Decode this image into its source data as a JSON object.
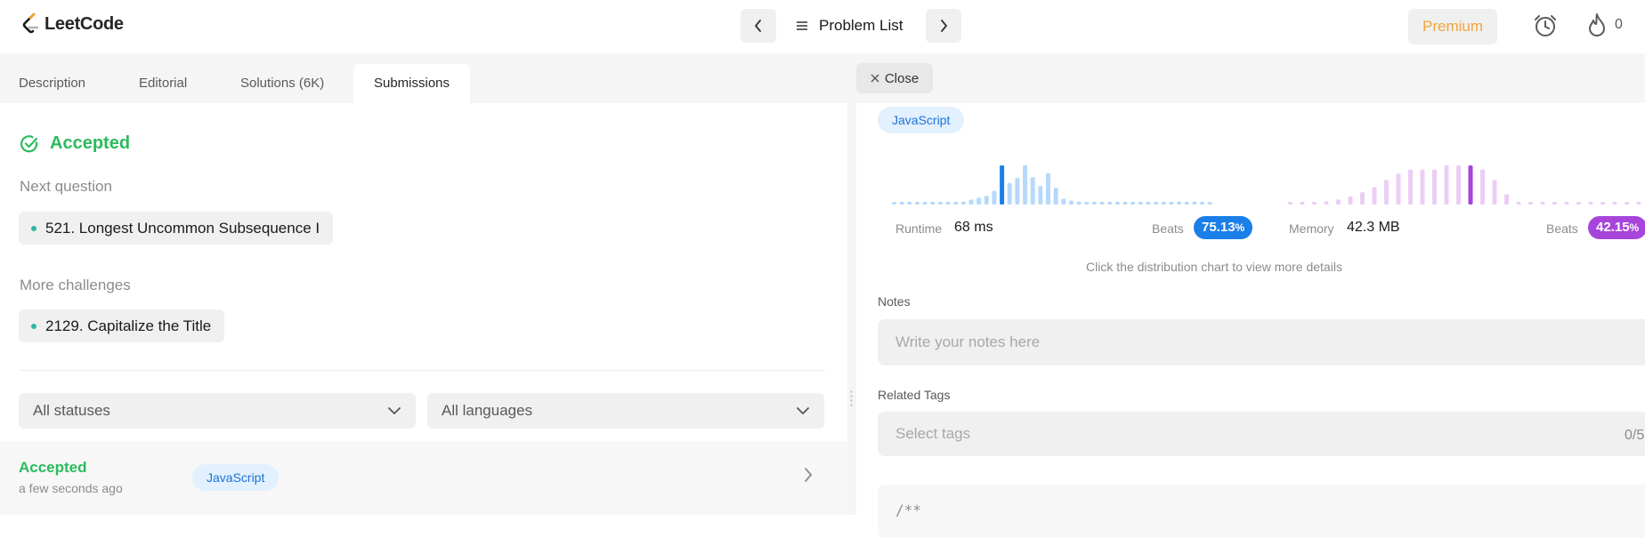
{
  "header": {
    "logo_text": "LeetCode",
    "problem_list_label": "Problem List",
    "premium_label": "Premium",
    "streak_count": "0",
    "accent_premium": "#f0a43a"
  },
  "tabs": [
    {
      "label": "Description"
    },
    {
      "label": "Editorial"
    },
    {
      "label": "Solutions (6K)"
    },
    {
      "label": "Submissions"
    }
  ],
  "close_label": "Close",
  "result": {
    "status": "Accepted",
    "status_color": "#2cbb5d",
    "next_question_label": "Next question",
    "next_question": "521. Longest Uncommon Subsequence I",
    "more_challenges_label": "More challenges",
    "more_challenge": "2129. Capitalize the Title"
  },
  "filters": {
    "status": "All statuses",
    "language": "All languages"
  },
  "submission": {
    "status": "Accepted",
    "time": "a few seconds ago",
    "language": "JavaScript"
  },
  "detail": {
    "language": "JavaScript",
    "runtime_label": "Runtime",
    "runtime_value": "68 ms",
    "runtime_beats_label": "Beats",
    "runtime_beats_main": "75.13",
    "runtime_beats_unit": "%",
    "memory_label": "Memory",
    "memory_value": "42.3 MB",
    "memory_beats_label": "Beats",
    "memory_beats_main": "42.15",
    "memory_beats_unit": "%",
    "hint": "Click the distribution chart to view more details",
    "notes_label": "Notes",
    "notes_placeholder": "Write your notes here",
    "tags_label": "Related Tags",
    "tags_placeholder": "Select tags",
    "tags_count": "0/5",
    "code_preview": "/**",
    "runtime_color": "#1a7fe8",
    "memory_color": "#a745db"
  },
  "chart_data": [
    {
      "type": "bar",
      "series_name": "Runtime distribution",
      "values": [
        1,
        1,
        1,
        1,
        1,
        1,
        1,
        1,
        2,
        3,
        5,
        7,
        9,
        14,
        40,
        22,
        27,
        40,
        28,
        19,
        32,
        17,
        6,
        4,
        3,
        2,
        2,
        1,
        1,
        1,
        1,
        1,
        1,
        1,
        1,
        2,
        2,
        3,
        2,
        3,
        2,
        1,
        1,
        1
      ],
      "highlight_index": 14,
      "base_color": "#b6d9fb",
      "highlight_color": "#1a7fe8"
    },
    {
      "type": "bar",
      "series_name": "Memory distribution",
      "values": [
        1,
        1,
        2,
        3,
        5,
        8,
        12,
        17,
        24,
        30,
        34,
        34,
        34,
        38,
        38,
        38,
        34,
        24,
        10,
        1,
        1,
        1,
        1,
        1,
        1,
        1,
        1,
        1,
        1,
        1
      ],
      "highlight_index": 15,
      "base_color": "#ebcdf6",
      "highlight_color": "#a745db"
    }
  ]
}
